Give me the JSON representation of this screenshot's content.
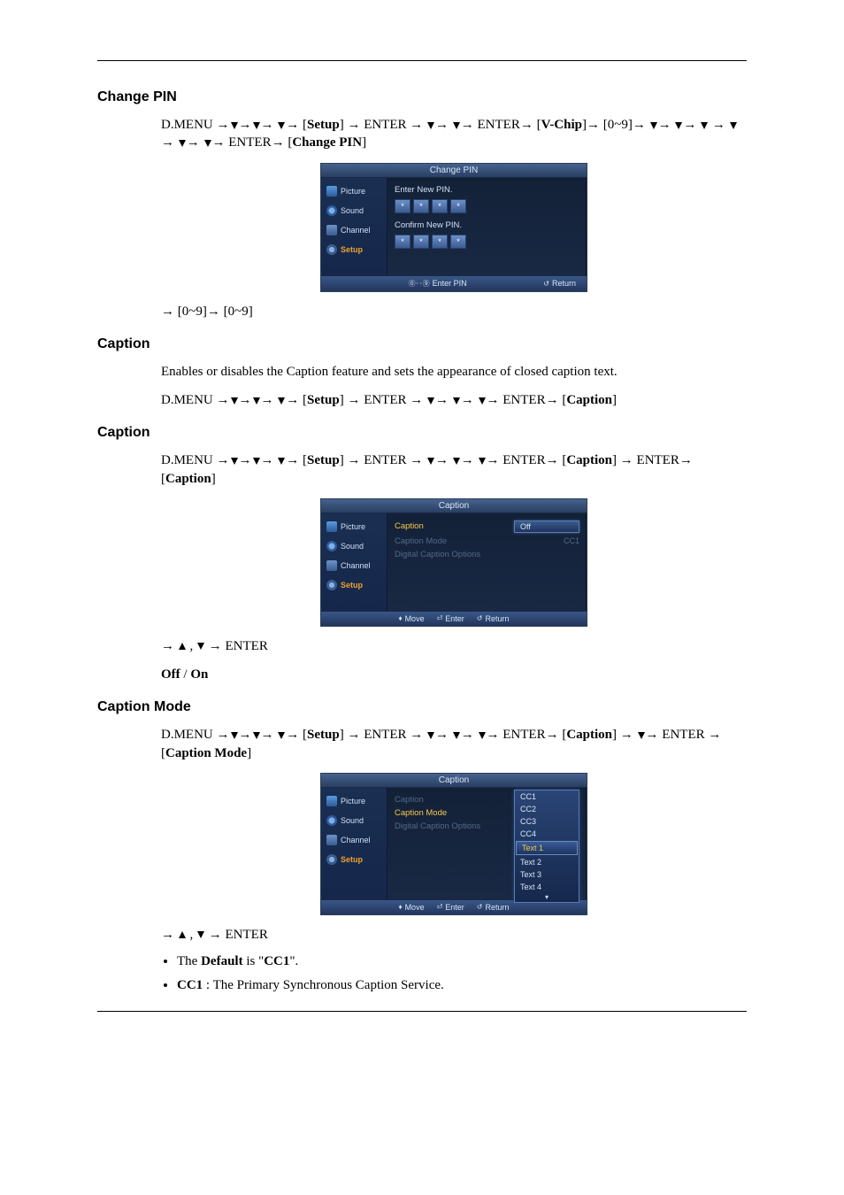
{
  "sections": {
    "change_pin": {
      "heading": "Change PIN",
      "path_prefix": "D.MENU →",
      "setup": "Setup",
      "enter1": " → ENTER → ",
      "enter2": " ENTER→ [",
      "vchip": "V-Chip",
      "mid": "]→ [0~9]→ ",
      "enter3": " ENTER→ [",
      "cp": "Change PIN",
      "tail": "→ [0~9]→ [0~9]"
    },
    "caption_intro": {
      "heading": "Caption",
      "desc": "Enables or disables the Caption feature and sets the appearance of closed caption text.",
      "path_prefix": "D.MENU →",
      "setup": "Setup",
      "enter1": " → ENTER → ",
      "enter2": " ENTER→ [",
      "caption": "Caption"
    },
    "caption_sub": {
      "heading": "Caption",
      "path_prefix": "D.MENU →",
      "setup": "Setup",
      "enter1": " → ENTER → ",
      "enter2": " ENTER→ [",
      "caption": "Caption",
      "mid": "] → ENTER→ [",
      "tail_pre": "→ ",
      "tail_enter": " → ENTER",
      "offon": "Off / On",
      "off": "Off",
      "on": "On"
    },
    "caption_mode": {
      "heading": "Caption Mode",
      "path_prefix": "D.MENU →",
      "setup": "Setup",
      "enter1": " → ENTER → ",
      "enter2": " ENTER→ [",
      "caption": "Caption",
      "mid": "] → ",
      "enter3": "→ ENTER → [",
      "cm": "Caption Mode",
      "tail_pre": "→ ",
      "tail_enter": " → ENTER",
      "bullet1_pre": "The ",
      "bullet1_def": "Default",
      "bullet1_mid": " is \"",
      "bullet1_cc1": "CC1",
      "bullet1_post": "\".",
      "bullet2_cc1": "CC1",
      "bullet2_rest": " : The Primary Synchronous Caption Service."
    }
  },
  "osd": {
    "sidebar": {
      "picture": "Picture",
      "sound": "Sound",
      "channel": "Channel",
      "setup": "Setup"
    },
    "change_pin": {
      "title": "Change PIN",
      "enter_new": "Enter New PIN.",
      "confirm_new": "Confirm New PIN.",
      "foot_enter": "Enter PIN",
      "foot_return": "Return"
    },
    "caption1": {
      "title": "Caption",
      "row_caption": "Caption",
      "row_mode": "Caption Mode",
      "row_digital": "Digital Caption Options",
      "val_off": "Off",
      "val_cc1": "CC1",
      "foot_move": "Move",
      "foot_enter": "Enter",
      "foot_return": "Return"
    },
    "caption2": {
      "title": "Caption",
      "row_caption": "Caption",
      "row_mode": "Caption Mode",
      "row_digital": "Digital Caption Options",
      "dd": [
        "CC1",
        "CC2",
        "CC3",
        "CC4",
        "Text 1",
        "Text 2",
        "Text 3",
        "Text 4"
      ],
      "foot_move": "Move",
      "foot_enter": "Enter",
      "foot_return": "Return"
    }
  }
}
